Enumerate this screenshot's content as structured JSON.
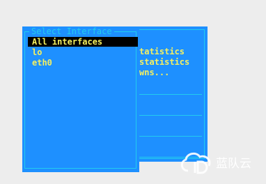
{
  "background_window": {
    "lines": [
      "tatistics",
      "statistics",
      "wns..."
    ]
  },
  "dialog": {
    "title": "Select Interface",
    "items": [
      "All interfaces",
      "lo",
      "eth0"
    ],
    "selected_index": 0
  },
  "watermark": {
    "text": "蓝队云"
  },
  "colors": {
    "desktop": "#ededed",
    "window": "#1e90ff",
    "border": "#22ccee",
    "text": "#f5f060",
    "selection": "#000000"
  }
}
